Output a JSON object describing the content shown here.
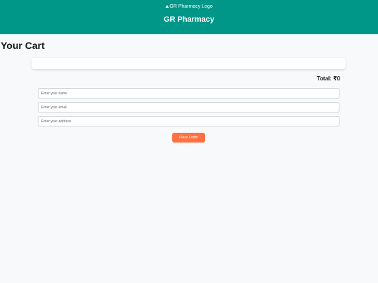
{
  "header": {
    "logo_alt": "GR Pharmacy Logo",
    "logo_icon": "broken-image-icon",
    "title": "GR Pharmacy"
  },
  "cart": {
    "heading": "Your Cart",
    "items": [],
    "total_label": "Total: ₹0"
  },
  "form": {
    "name_placeholder": "Enter your name",
    "email_placeholder": "Enter your email",
    "address_placeholder": "Enter your address",
    "submit_label": "Place Order"
  },
  "colors": {
    "header_bg": "#009688",
    "button_bg": "#ff7043",
    "page_bg": "#f7f9fb"
  }
}
